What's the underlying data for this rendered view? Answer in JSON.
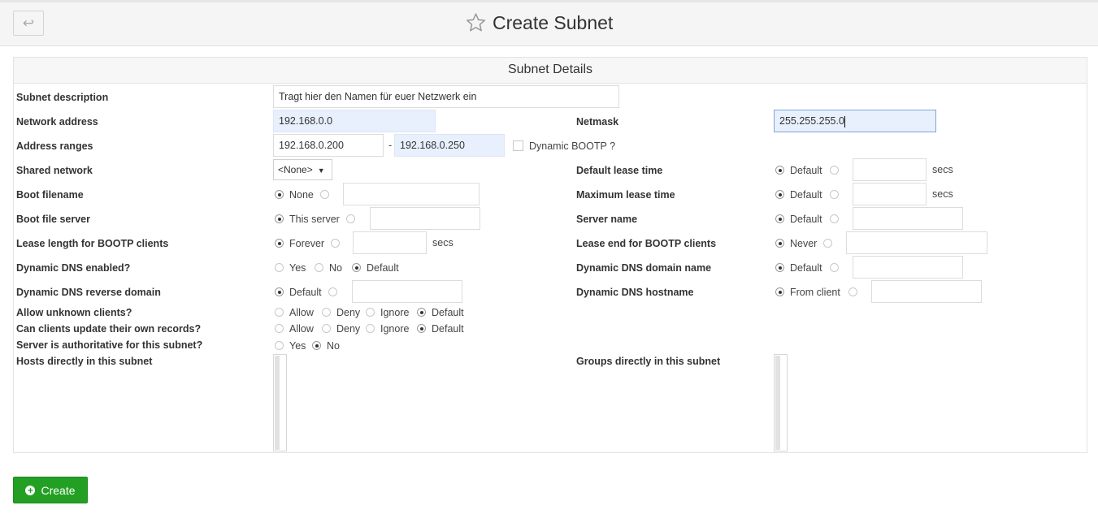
{
  "header": {
    "title": "Create Subnet",
    "back_icon": "↩"
  },
  "panel": {
    "title": "Subnet Details"
  },
  "form": {
    "subnet_description": {
      "label": "Subnet description",
      "value": "Tragt hier den Namen für euer Netzwerk ein"
    },
    "network_address": {
      "label": "Network address",
      "value": "192.168.0.0"
    },
    "netmask": {
      "label": "Netmask",
      "value": "255.255.255.0"
    },
    "address_ranges": {
      "label": "Address ranges",
      "from": "192.168.0.200",
      "separator": "-",
      "to": "192.168.0.250",
      "dynamic_bootp": "Dynamic BOOTP ?"
    },
    "shared_network": {
      "label": "Shared network",
      "value": "<None>",
      "arrow": "▼"
    },
    "default_lease_time": {
      "label": "Default lease time",
      "option_default": "Default",
      "unit": "secs"
    },
    "boot_filename": {
      "label": "Boot filename",
      "option_none": "None"
    },
    "maximum_lease_time": {
      "label": "Maximum lease time",
      "option_default": "Default",
      "unit": "secs"
    },
    "boot_file_server": {
      "label": "Boot file server",
      "option_this": "This server"
    },
    "server_name": {
      "label": "Server name",
      "option_default": "Default"
    },
    "lease_length_bootp": {
      "label": "Lease length for BOOTP clients",
      "option_forever": "Forever",
      "unit": "secs"
    },
    "lease_end_bootp": {
      "label": "Lease end for BOOTP clients",
      "option_never": "Never"
    },
    "ddns_enabled": {
      "label": "Dynamic DNS enabled?",
      "opt_yes": "Yes",
      "opt_no": "No",
      "opt_default": "Default"
    },
    "ddns_domain_name": {
      "label": "Dynamic DNS domain name",
      "option_default": "Default"
    },
    "ddns_reverse_domain": {
      "label": "Dynamic DNS reverse domain",
      "option_default": "Default"
    },
    "ddns_hostname": {
      "label": "Dynamic DNS hostname",
      "option_from_client": "From client"
    },
    "allow_unknown": {
      "label": "Allow unknown clients?",
      "opt_allow": "Allow",
      "opt_deny": "Deny",
      "opt_ignore": "Ignore",
      "opt_default": "Default"
    },
    "client_updates": {
      "label": "Can clients update their own records?",
      "opt_allow": "Allow",
      "opt_deny": "Deny",
      "opt_ignore": "Ignore",
      "opt_default": "Default"
    },
    "authoritative": {
      "label": "Server is authoritative for this subnet?",
      "opt_yes": "Yes",
      "opt_no": "No"
    },
    "hosts_in_subnet": {
      "label": "Hosts directly in this subnet"
    },
    "groups_in_subnet": {
      "label": "Groups directly in this subnet"
    }
  },
  "actions": {
    "create_label": "Create",
    "create_icon": "+"
  }
}
